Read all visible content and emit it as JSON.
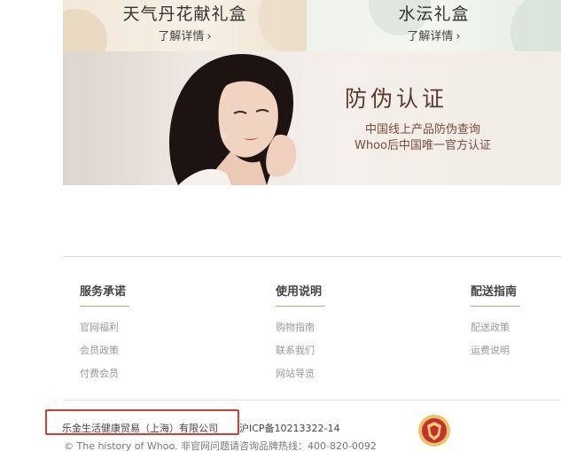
{
  "promos": [
    {
      "title": "天气丹花献礼盒",
      "link_label": "了解详情",
      "chevron": "›"
    },
    {
      "title": "水沄礼盒",
      "link_label": "了解详情",
      "chevron": "›"
    }
  ],
  "banner": {
    "title": "防伪认证",
    "line1": "中国线上产品防伪查询",
    "line2": "Whoo后中国唯一官方认证"
  },
  "footer": {
    "columns": [
      {
        "title": "服务承诺",
        "links": [
          "官网福利",
          "会员政策",
          "付费会员"
        ]
      },
      {
        "title": "使用说明",
        "links": [
          "购物指南",
          "联系我们",
          "网站导览"
        ]
      },
      {
        "title": "配送指南",
        "links": [
          "配送政策",
          "运费说明"
        ]
      }
    ],
    "company": "乐金生活健康贸易（上海）有限公司",
    "icp": "沪ICP备10213322-14",
    "copyright": "© The history of Whoo. 非官网问题请咨询品牌热线：400-820-0092",
    "badge_icon": "red-shield-badge-icon"
  },
  "colors": {
    "accent_underline": "#bca77f",
    "highlight_box": "#d63b34",
    "banner_text": "#5a3a33"
  }
}
